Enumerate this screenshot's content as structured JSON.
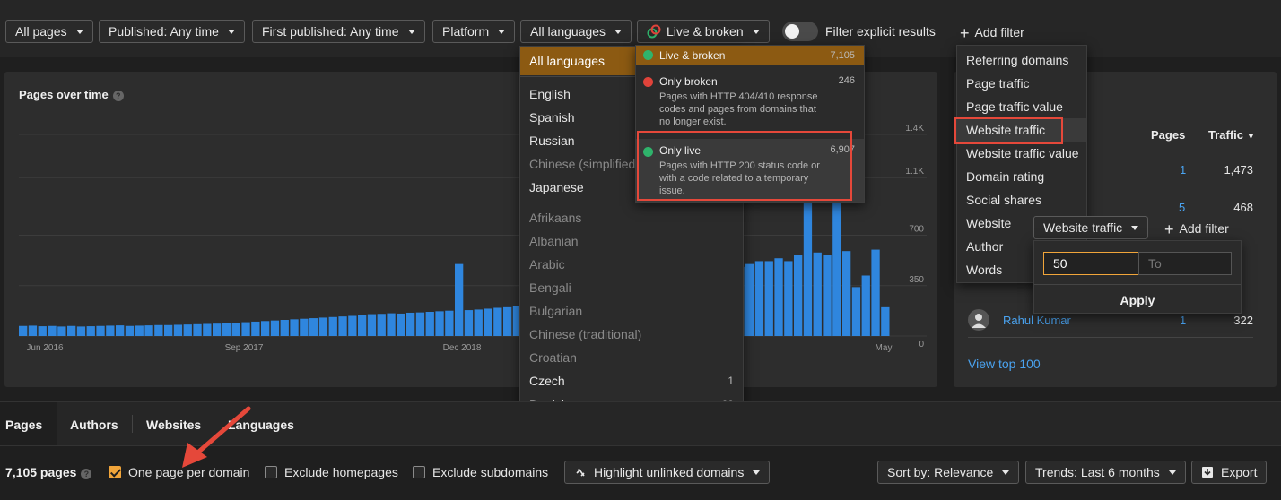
{
  "filters": {
    "all_pages": "All pages",
    "published": "Published: Any time",
    "first_published": "First published: Any time",
    "platform": "Platform",
    "languages": "All languages",
    "status": "Live & broken",
    "explicit_label": "Filter explicit results",
    "add_filter": "Add filter"
  },
  "chart": {
    "title": "Pages over time",
    "x_ticks": [
      "Jun 2016",
      "Sep 2017",
      "Dec 2018",
      "May"
    ],
    "y_ticks": [
      "1.4K",
      "1.1K",
      "700",
      "350",
      "0"
    ]
  },
  "chart_data": {
    "type": "bar",
    "title": "Pages over time",
    "x_ticks": [
      "Jun 2016",
      "Sep 2017",
      "Dec 2018",
      "May"
    ],
    "y_ticks": [
      "0",
      "350",
      "700",
      "1.1K",
      "1.4K"
    ],
    "ylim": [
      0,
      1400
    ],
    "values": [
      70,
      72,
      68,
      70,
      66,
      70,
      66,
      68,
      70,
      72,
      74,
      70,
      72,
      74,
      76,
      76,
      78,
      80,
      82,
      84,
      86,
      90,
      92,
      96,
      100,
      104,
      108,
      112,
      116,
      120,
      124,
      128,
      132,
      136,
      140,
      148,
      152,
      154,
      158,
      156,
      162,
      164,
      168,
      172,
      176,
      500,
      180,
      184,
      190,
      196,
      200,
      206,
      210,
      216,
      222,
      228,
      236,
      244,
      252,
      260,
      268,
      276,
      284,
      292,
      300,
      308,
      320,
      340,
      360,
      380,
      400,
      420,
      440,
      460,
      480,
      500,
      520,
      520,
      540,
      520,
      560,
      1850,
      580,
      560,
      1850,
      590,
      340,
      420,
      600,
      200
    ]
  },
  "right_panel": {
    "col_pages": "Pages",
    "col_traffic": "Traffic",
    "rows": [
      {
        "pages": "1",
        "traffic": "1,473"
      },
      {
        "pages": "5",
        "traffic": "468"
      }
    ],
    "author_name": "Rahul Kumar",
    "author_pages": "1",
    "author_traffic": "322",
    "view_top": "View top 100"
  },
  "language_menu": {
    "selected": "All languages",
    "top": [
      {
        "label": "English",
        "count": ""
      },
      {
        "label": "Spanish",
        "count": ""
      },
      {
        "label": "Russian",
        "count": ""
      },
      {
        "label": "Chinese (simplified)",
        "count": "",
        "dim": true
      },
      {
        "label": "Japanese",
        "count": ""
      }
    ],
    "rest": [
      {
        "label": "Afrikaans",
        "count": "",
        "dim": true
      },
      {
        "label": "Albanian",
        "count": "",
        "dim": true
      },
      {
        "label": "Arabic",
        "count": "",
        "dim": true
      },
      {
        "label": "Bengali",
        "count": "",
        "dim": true
      },
      {
        "label": "Bulgarian",
        "count": "",
        "dim": true
      },
      {
        "label": "Chinese (traditional)",
        "count": "",
        "dim": true
      },
      {
        "label": "Croatian",
        "count": "",
        "dim": true
      },
      {
        "label": "Czech",
        "count": "1"
      },
      {
        "label": "Danish",
        "count": "29"
      }
    ]
  },
  "status_menu": {
    "live_broken": {
      "title": "Live & broken",
      "count": "7,105"
    },
    "only_broken": {
      "title": "Only broken",
      "count": "246",
      "desc": "Pages with HTTP 404/410 response codes and pages from domains that no longer exist."
    },
    "only_live": {
      "title": "Only live",
      "count": "6,907",
      "desc": "Pages with HTTP 200 status code or with a code related to a temporary issue."
    }
  },
  "addfilter_menu": {
    "items": [
      "Referring domains",
      "Page traffic",
      "Page traffic value",
      "Website traffic",
      "Website traffic value",
      "Domain rating",
      "Social shares",
      "Website",
      "Author",
      "Words"
    ]
  },
  "range_popup": {
    "select_label": "Website traffic",
    "add_filter": "Add filter",
    "from_value": "50",
    "to_placeholder": "To",
    "apply": "Apply"
  },
  "tabs": [
    "Pages",
    "Authors",
    "Websites",
    "Languages"
  ],
  "bottom": {
    "count": "7,105 pages",
    "one_per_domain": "One page per domain",
    "exclude_homepages": "Exclude homepages",
    "exclude_subdomains": "Exclude subdomains",
    "highlight": "Highlight unlinked domains",
    "sort": "Sort by: Relevance",
    "trends": "Trends: Last 6 months",
    "export": "Export"
  },
  "colors": {
    "bar": "#2f86de",
    "accent": "#f1a53a",
    "highlight_box": "#e5483a",
    "link": "#4aa3f0"
  }
}
